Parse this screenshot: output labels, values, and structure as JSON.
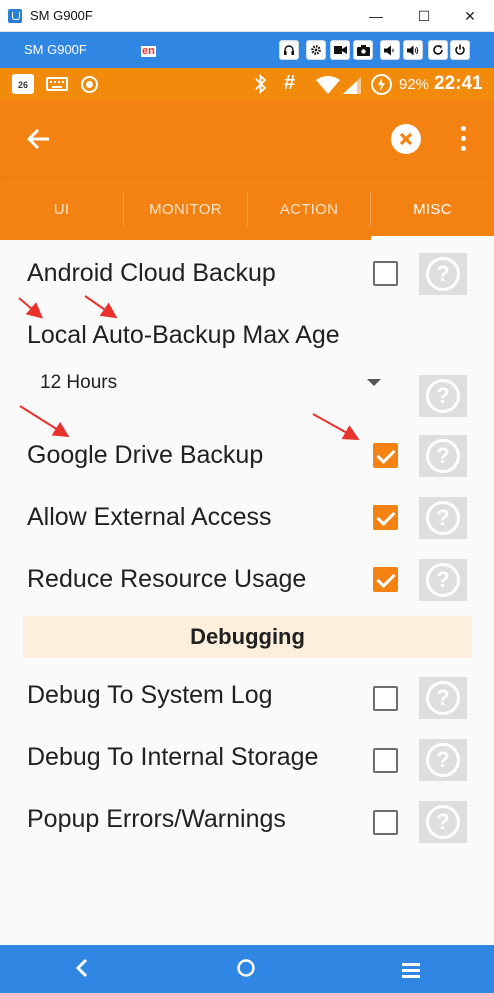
{
  "window": {
    "title": "SM G900F",
    "minimize": "—",
    "maximize": "☐",
    "close": "✕"
  },
  "scrcpy": {
    "device": "SM G900F",
    "lang": "en",
    "buttons": [
      "headphone-icon",
      "gear-icon",
      "video-icon",
      "camera-icon",
      "volume-down-icon",
      "volume-up-icon",
      "rotate-icon",
      "power-icon"
    ]
  },
  "status_bar": {
    "battery_pct": "92%",
    "time": "22:41",
    "calendar_day": "26"
  },
  "tabs": [
    {
      "label": "UI",
      "active": false
    },
    {
      "label": "MONITOR",
      "active": false
    },
    {
      "label": "ACTION",
      "active": false
    },
    {
      "label": "MISC",
      "active": true
    }
  ],
  "settings": [
    {
      "label": "Android Cloud Backup",
      "checked": false
    },
    {
      "label": "Local Auto-Backup Max Age"
    },
    {
      "label": "Google Drive Backup",
      "checked": true
    },
    {
      "label": "Allow External Access",
      "checked": true
    },
    {
      "label": "Reduce Resource Usage",
      "checked": true
    },
    {
      "label": "Debug To System Log",
      "checked": false
    },
    {
      "label": "Debug To Internal Storage",
      "checked": false
    },
    {
      "label": "Popup Errors/Warnings",
      "checked": false
    }
  ],
  "max_age": {
    "value": "12 Hours"
  },
  "section_header": "Debugging",
  "help_glyph": "?",
  "colors": {
    "accent": "#f48213",
    "status_bar": "#f28a0c",
    "host_bar": "#2f86e3",
    "section_bg": "#fcefdc",
    "annotation_arrow": "#e8322c"
  }
}
